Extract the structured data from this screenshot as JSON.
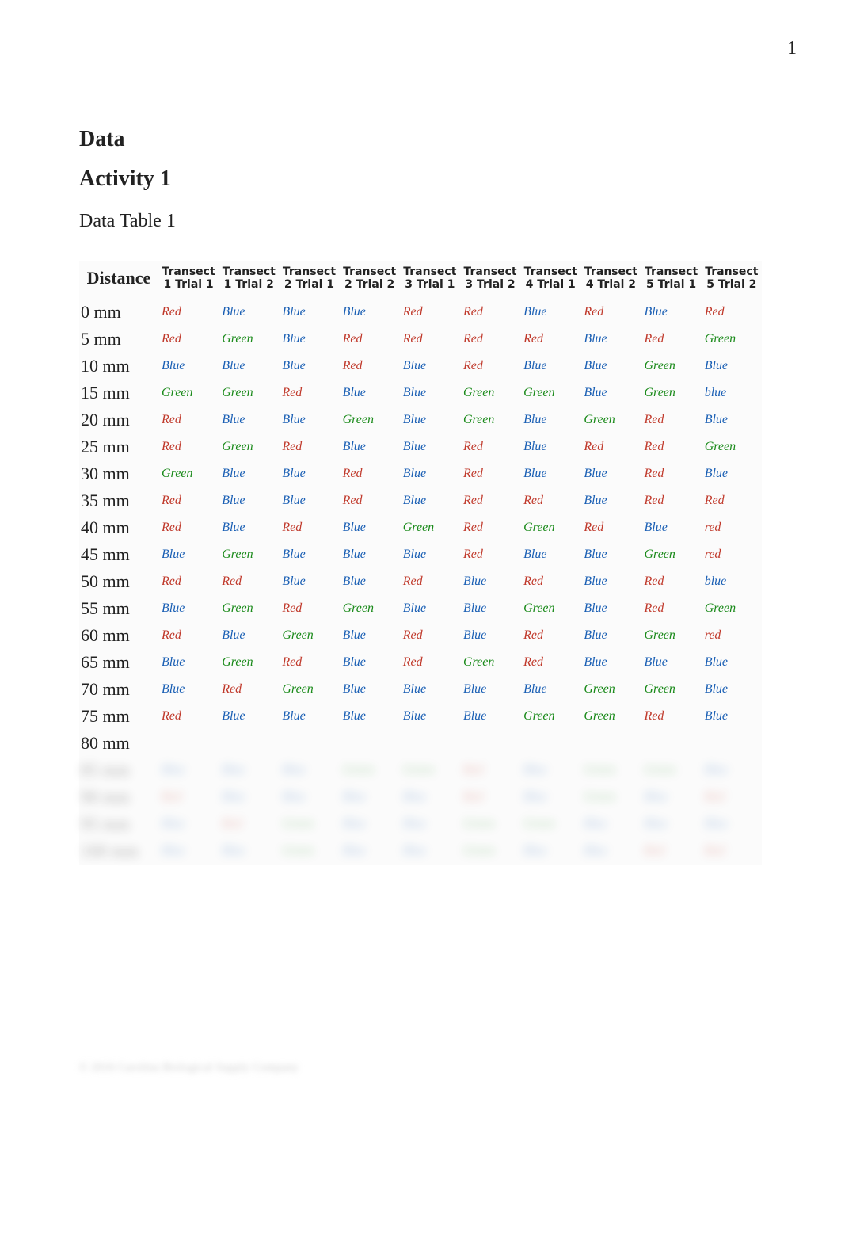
{
  "pageNumber": "1",
  "headings": {
    "data": "Data",
    "activity": "Activity 1",
    "subtitle": "Data Table 1"
  },
  "columns": {
    "distance": "Distance",
    "c1t1": "Transect 1 Trial 1",
    "c1t2": "Transect 1 Trial 2",
    "c2t1": "Transect 2 Trial 1",
    "c2t2": "Transect 2 Trial 2",
    "c3t1": "Transect 3 Trial 1",
    "c3t2": "Transect 3 Trial 2",
    "c4t1": "Transect 4 Trial 1",
    "c4t2": "Transect 4 Trial 2",
    "c5t1": "Transect 5 Trial 1",
    "c5t2": "Transect 5 Trial 2"
  },
  "rows": [
    {
      "distance": "0 mm",
      "vals": [
        "Red",
        "Blue",
        "Blue",
        "Blue",
        "Red",
        "Red",
        "Blue",
        "Red",
        "Blue",
        "Red"
      ]
    },
    {
      "distance": "5 mm",
      "vals": [
        "Red",
        "Green",
        "Blue",
        "Red",
        "Red",
        "Red",
        "Red",
        "Blue",
        "Red",
        "Green"
      ]
    },
    {
      "distance": "10 mm",
      "vals": [
        "Blue",
        "Blue",
        "Blue",
        "Red",
        "Blue",
        "Red",
        "Blue",
        "Blue",
        "Green",
        "Blue"
      ]
    },
    {
      "distance": "15 mm",
      "vals": [
        "Green",
        "Green",
        "Red",
        "Blue",
        "Blue",
        "Green",
        "Green",
        "Blue",
        "Green",
        "blue"
      ]
    },
    {
      "distance": "20 mm",
      "vals": [
        "Red",
        "Blue",
        "Blue",
        "Green",
        "Blue",
        "Green",
        "Blue",
        "Green",
        "Red",
        "Blue"
      ]
    },
    {
      "distance": "25 mm",
      "vals": [
        "Red",
        "Green",
        "Red",
        "Blue",
        "Blue",
        "Red",
        "Blue",
        "Red",
        "Red",
        "Green"
      ]
    },
    {
      "distance": "30 mm",
      "vals": [
        "Green",
        "Blue",
        "Blue",
        "Red",
        "Blue",
        "Red",
        "Blue",
        "Blue",
        "Red",
        "Blue"
      ]
    },
    {
      "distance": "35 mm",
      "vals": [
        "Red",
        "Blue",
        "Blue",
        "Red",
        "Blue",
        "Red",
        "Red",
        "Blue",
        "Red",
        "Red"
      ]
    },
    {
      "distance": "40 mm",
      "vals": [
        "Red",
        "Blue",
        "Red",
        "Blue",
        "Green",
        "Red",
        "Green",
        "Red",
        "Blue",
        "red"
      ]
    },
    {
      "distance": "45 mm",
      "vals": [
        "Blue",
        "Green",
        "Blue",
        "Blue",
        "Blue",
        "Red",
        "Blue",
        "Blue",
        "Green",
        "red"
      ]
    },
    {
      "distance": "50 mm",
      "vals": [
        "Red",
        "Red",
        "Blue",
        "Blue",
        "Red",
        "Blue",
        "Red",
        "Blue",
        "Red",
        "blue"
      ]
    },
    {
      "distance": "55 mm",
      "vals": [
        "Blue",
        "Green",
        "Red",
        "Green",
        "Blue",
        "Blue",
        "Green",
        "Blue",
        "Red",
        "Green"
      ]
    },
    {
      "distance": "60 mm",
      "vals": [
        "Red",
        "Blue",
        "Green",
        "Blue",
        "Red",
        "Blue",
        "Red",
        "Blue",
        "Green",
        "red"
      ]
    },
    {
      "distance": "65 mm",
      "vals": [
        "Blue",
        "Green",
        "Red",
        "Blue",
        "Red",
        "Green",
        "Red",
        "Blue",
        "Blue",
        "Blue"
      ]
    },
    {
      "distance": "70 mm",
      "vals": [
        "Blue",
        "Red",
        "Green",
        "Blue",
        "Blue",
        "Blue",
        "Blue",
        "Green",
        "Green",
        "Blue"
      ]
    },
    {
      "distance": "75 mm",
      "vals": [
        "Red",
        "Blue",
        "Blue",
        "Blue",
        "Blue",
        "Blue",
        "Green",
        "Green",
        "Red",
        "Blue"
      ]
    },
    {
      "distance": "80 mm",
      "vals": [
        "",
        "",
        "",
        "",
        "",
        "",
        "",
        "",
        "",
        ""
      ]
    }
  ],
  "blurRows": [
    {
      "distance": "85 mm",
      "vals": [
        "Blue",
        "Blue",
        "Blue",
        "Green",
        "Green",
        "Red",
        "Blue",
        "Green",
        "Green",
        "Blue"
      ]
    },
    {
      "distance": "90 mm",
      "vals": [
        "Red",
        "Blue",
        "Blue",
        "Blue",
        "Blue",
        "Red",
        "Blue",
        "Green",
        "Blue",
        "Red"
      ]
    },
    {
      "distance": "95 mm",
      "vals": [
        "Blue",
        "Red",
        "Green",
        "Blue",
        "Blue",
        "Green",
        "Green",
        "Blue",
        "Blue",
        "Blue"
      ]
    },
    {
      "distance": "100 mm",
      "vals": [
        "Blue",
        "Blue",
        "Green",
        "Blue",
        "Blue",
        "Green",
        "Blue",
        "Blue",
        "Red",
        "Red"
      ]
    }
  ],
  "footerBlur": "© 2016 Carolina Biological Supply Company"
}
